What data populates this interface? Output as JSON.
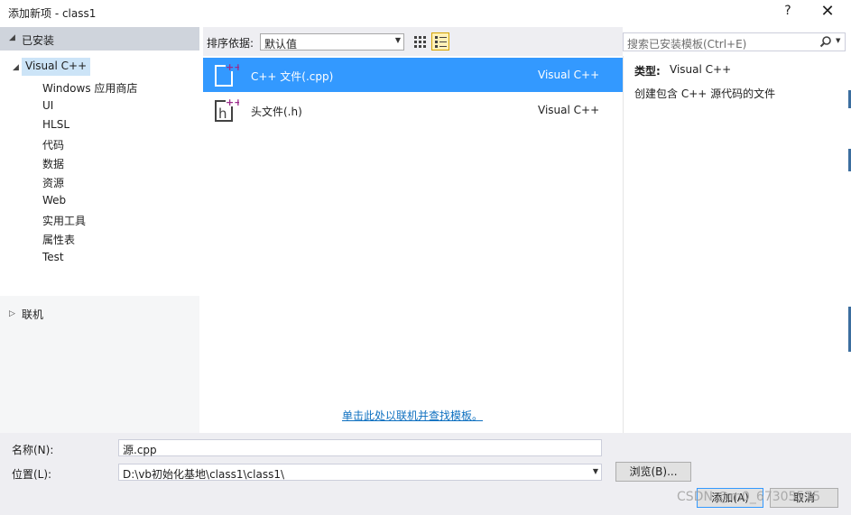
{
  "window": {
    "title": "添加新项 - class1",
    "help_label": "?",
    "close_label": "✕"
  },
  "left": {
    "installed_label": "已安装",
    "root_label": "Visual C++",
    "children": [
      "Windows 应用商店",
      "UI",
      "HLSL",
      "代码",
      "数据",
      "资源",
      "Web",
      "实用工具",
      "属性表",
      "Test"
    ],
    "online_label": "联机"
  },
  "toolbar": {
    "sort_label": "排序依据:",
    "sort_value": "默认值"
  },
  "search": {
    "placeholder": "搜索已安装模板(Ctrl+E)"
  },
  "templates": [
    {
      "name": "C++ 文件(.cpp)",
      "type": "Visual C++",
      "selected": true
    },
    {
      "name": "头文件(.h)",
      "type": "Visual C++",
      "selected": false
    }
  ],
  "online_link": "单击此处以联机并查找模板。",
  "details": {
    "type_label": "类型:",
    "type_value": "Visual C++",
    "description": "创建包含 C++ 源代码的文件"
  },
  "form": {
    "name_label": "名称(N):",
    "name_value": "源.cpp",
    "location_label": "位置(L):",
    "location_value": "D:\\vb初始化基地\\class1\\class1\\",
    "browse_label": "浏览(B)...",
    "add_label": "添加(A)",
    "cancel_label": "取消"
  },
  "watermark": "CSDN @m0_67305575",
  "colors": {
    "selection": "#3399ff",
    "link": "#0e70c0",
    "header_bg": "#cfd4dc",
    "pane_bg": "#eeeef2"
  }
}
